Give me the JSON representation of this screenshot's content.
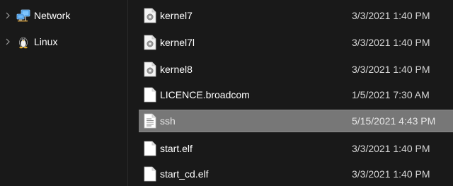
{
  "navigation": {
    "items": [
      {
        "label": "Network",
        "icon": "network-icon"
      },
      {
        "label": "Linux",
        "icon": "linux-penguin-icon"
      }
    ]
  },
  "files": [
    {
      "name": "kernel7",
      "modified": "3/3/2021 1:40 PM",
      "icon": "system-file-icon"
    },
    {
      "name": "kernel7l",
      "modified": "3/3/2021 1:40 PM",
      "icon": "system-file-icon"
    },
    {
      "name": "kernel8",
      "modified": "3/3/2021 1:40 PM",
      "icon": "system-file-icon"
    },
    {
      "name": "LICENCE.broadcom",
      "modified": "1/5/2021 7:30 AM",
      "icon": "file-icon"
    },
    {
      "name": "ssh",
      "modified": "5/15/2021 4:43 PM",
      "icon": "text-file-icon",
      "selected": true
    },
    {
      "name": "start.elf",
      "modified": "3/3/2021 1:40 PM",
      "icon": "file-icon"
    },
    {
      "name": "start_cd.elf",
      "modified": "3/3/2021 1:40 PM",
      "icon": "file-icon"
    }
  ],
  "colors": {
    "background": "#191919",
    "selection": "#777777",
    "text": "#ffffff",
    "date_text": "#d6d6d6"
  }
}
